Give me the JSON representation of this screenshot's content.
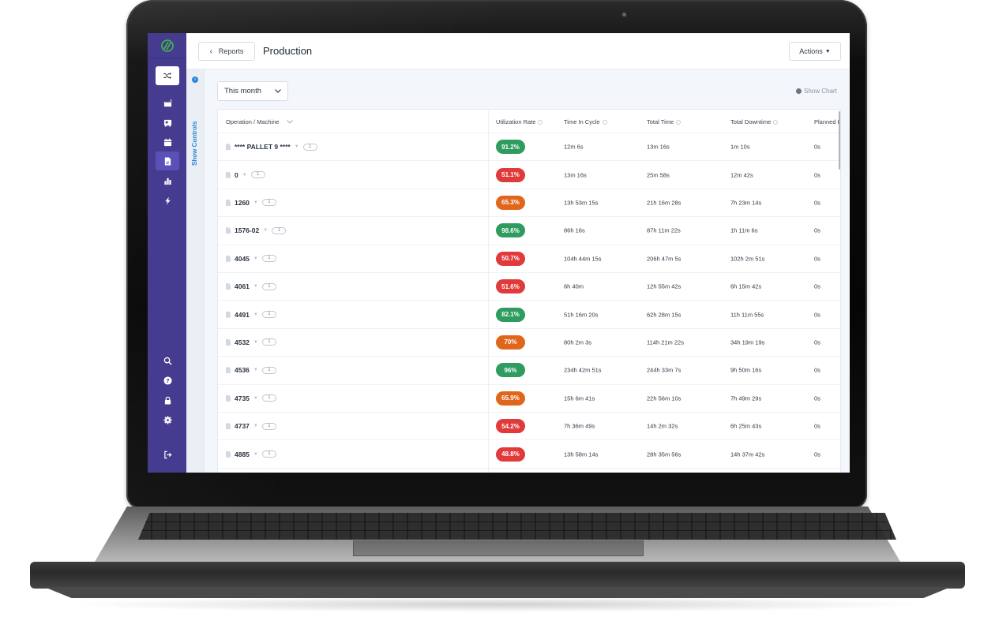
{
  "device": {
    "type": "laptop"
  },
  "sidebar": {
    "logo": "logo-icon",
    "shuffle": "shuffle-icon",
    "nav_top": [
      {
        "icon": "factory-icon",
        "active": false
      },
      {
        "icon": "machine-icon",
        "active": false
      },
      {
        "icon": "calendar-icon",
        "active": false
      },
      {
        "icon": "report-icon",
        "active": true
      },
      {
        "icon": "bar-chart-icon",
        "active": false
      },
      {
        "icon": "lightning-icon",
        "active": false
      }
    ],
    "nav_bottom": [
      {
        "icon": "search-icon"
      },
      {
        "icon": "help-icon"
      },
      {
        "icon": "lock-icon"
      },
      {
        "icon": "gear-icon"
      },
      {
        "icon": "logout-icon"
      }
    ]
  },
  "controls_strip": {
    "label": "Show Controls"
  },
  "header": {
    "back_label": "Reports",
    "title": "Production",
    "actions_label": "Actions"
  },
  "filters": {
    "period": "This month",
    "show_chart_label": "Show Chart"
  },
  "table": {
    "columns": [
      {
        "label": "Operation / Machine",
        "sortable": true
      },
      {
        "label": "Utilization Rate",
        "info": true
      },
      {
        "label": "Time In Cycle",
        "info": true
      },
      {
        "label": "Total Time",
        "info": true
      },
      {
        "label": "Total Downtime",
        "info": true
      },
      {
        "label": "Planned D"
      }
    ],
    "rows": [
      {
        "name": "**** PALLET 9 ****",
        "count": "1",
        "utilization": "91.2%",
        "status": "good",
        "time_in_cycle": "12m 6s",
        "total_time": "13m 16s",
        "total_downtime": "1m 10s",
        "planned": "0s"
      },
      {
        "name": "0",
        "count": "1",
        "utilization": "51.1%",
        "status": "bad",
        "time_in_cycle": "13m 16s",
        "total_time": "25m 58s",
        "total_downtime": "12m 42s",
        "planned": "0s"
      },
      {
        "name": "1260",
        "count": "1",
        "utilization": "65.3%",
        "status": "warn",
        "time_in_cycle": "13h 53m 15s",
        "total_time": "21h 16m 28s",
        "total_downtime": "7h 23m 14s",
        "planned": "0s"
      },
      {
        "name": "1576-02",
        "count": "1",
        "utilization": "98.6%",
        "status": "good",
        "time_in_cycle": "86h 16s",
        "total_time": "87h 11m 22s",
        "total_downtime": "1h 11m 6s",
        "planned": "0s"
      },
      {
        "name": "4045",
        "count": "1",
        "utilization": "50.7%",
        "status": "bad",
        "time_in_cycle": "104h 44m 15s",
        "total_time": "206h 47m 5s",
        "total_downtime": "102h 2m 51s",
        "planned": "0s"
      },
      {
        "name": "4061",
        "count": "1",
        "utilization": "51.6%",
        "status": "bad",
        "time_in_cycle": "6h 40m",
        "total_time": "12h 55m 42s",
        "total_downtime": "6h 15m 42s",
        "planned": "0s"
      },
      {
        "name": "4491",
        "count": "1",
        "utilization": "82.1%",
        "status": "good",
        "time_in_cycle": "51h 16m 20s",
        "total_time": "62h 28m 15s",
        "total_downtime": "11h 11m 55s",
        "planned": "0s"
      },
      {
        "name": "4532",
        "count": "1",
        "utilization": "70%",
        "status": "warn",
        "time_in_cycle": "80h 2m 3s",
        "total_time": "114h 21m 22s",
        "total_downtime": "34h 19m 19s",
        "planned": "0s"
      },
      {
        "name": "4536",
        "count": "1",
        "utilization": "96%",
        "status": "good",
        "time_in_cycle": "234h 42m 51s",
        "total_time": "244h 33m 7s",
        "total_downtime": "9h 50m 16s",
        "planned": "0s"
      },
      {
        "name": "4735",
        "count": "1",
        "utilization": "65.9%",
        "status": "warn",
        "time_in_cycle": "15h 6m 41s",
        "total_time": "22h 56m 10s",
        "total_downtime": "7h 49m 29s",
        "planned": "0s"
      },
      {
        "name": "4737",
        "count": "1",
        "utilization": "54.2%",
        "status": "bad",
        "time_in_cycle": "7h 36m 49s",
        "total_time": "14h 2m 32s",
        "total_downtime": "6h 25m 43s",
        "planned": "0s"
      },
      {
        "name": "4885",
        "count": "1",
        "utilization": "48.8%",
        "status": "bad",
        "time_in_cycle": "13h 58m 14s",
        "total_time": "28h 35m 56s",
        "total_downtime": "14h 37m 42s",
        "planned": "0s"
      }
    ]
  },
  "colors": {
    "sidebar": "#453c8f",
    "accent": "#2e86d6",
    "good": "#2e9b5f",
    "warn": "#e0661c",
    "bad": "#e03a3a",
    "logo": "#3fbf3f"
  }
}
